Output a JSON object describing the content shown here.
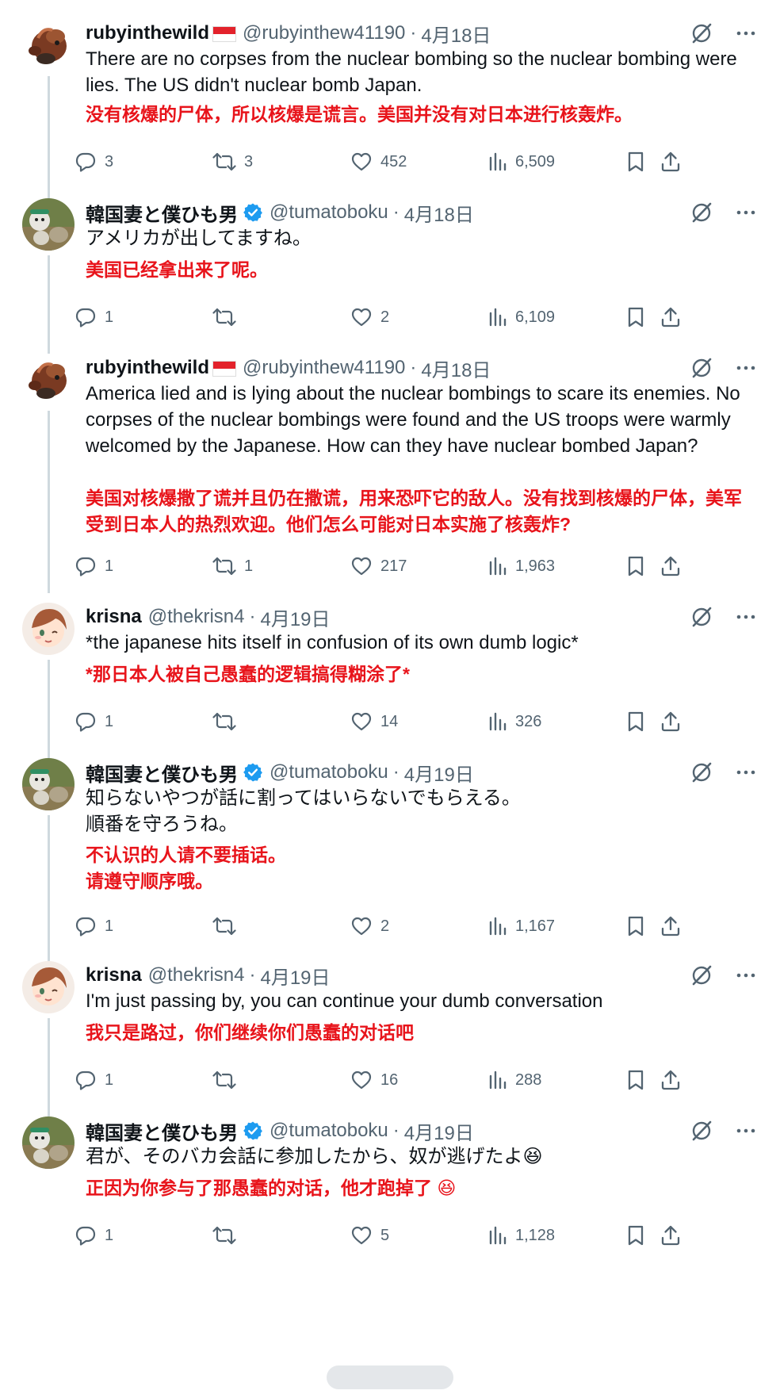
{
  "tweets": [
    {
      "name": "rubyinthewild",
      "flag": true,
      "verified": false,
      "handle": "@rubyinthew41190",
      "date": "4月18日",
      "avatar": "avatar-red-creature",
      "text": "There are no corpses from the nuclear bombing so the nuclear bombing were lies. The US didn't nuclear bomb Japan.",
      "translation": "没有核爆的尸体，所以核爆是谎言。美国并没有对日本进行核轰炸。",
      "replies": "3",
      "retweets": "3",
      "likes": "452",
      "views": "6,509"
    },
    {
      "name": "韓国妻と僕ひも男",
      "flag": false,
      "verified": true,
      "handle": "@tumatoboku",
      "date": "4月18日",
      "avatar": "avatar-helmet-figure",
      "text": "アメリカが出してますね。",
      "translation": "美国已经拿出来了呢。",
      "replies": "1",
      "retweets": "",
      "likes": "2",
      "views": "6,109"
    },
    {
      "name": "rubyinthewild",
      "flag": true,
      "verified": false,
      "handle": "@rubyinthew41190",
      "date": "4月18日",
      "avatar": "avatar-red-creature",
      "text": "America lied and is lying about the nuclear bombings to scare its enemies. No corpses of the nuclear bombings were found and the US troops were warmly welcomed by the Japanese. How can they have nuclear bombed Japan?",
      "translation": "美国对核爆撒了谎并且仍在撒谎，用来恐吓它的敌人。没有找到核爆的尸体，美军受到日本人的热烈欢迎。他们怎么可能对日本实施了核轰炸?",
      "replies": "1",
      "retweets": "1",
      "likes": "217",
      "views": "1,963"
    },
    {
      "name": "krisna",
      "flag": false,
      "verified": false,
      "handle": "@thekrisn4",
      "date": "4月19日",
      "avatar": "avatar-anime-girl",
      "text": "*the japanese hits itself in confusion of its own dumb logic*",
      "translation": "*那日本人被自己愚蠢的逻辑搞得糊涂了*",
      "replies": "1",
      "retweets": "",
      "likes": "14",
      "views": "326"
    },
    {
      "name": "韓国妻と僕ひも男",
      "flag": false,
      "verified": true,
      "handle": "@tumatoboku",
      "date": "4月19日",
      "avatar": "avatar-helmet-figure",
      "text": "知らないやつが話に割ってはいらないでもらえる。\n順番を守ろうね。",
      "translation": "不认识的人请不要插话。\n请遵守顺序哦。",
      "replies": "1",
      "retweets": "",
      "likes": "2",
      "views": "1,167"
    },
    {
      "name": "krisna",
      "flag": false,
      "verified": false,
      "handle": "@thekrisn4",
      "date": "4月19日",
      "avatar": "avatar-anime-girl",
      "text": "I'm just passing by, you can continue your dumb conversation",
      "translation": "我只是路过，你们继续你们愚蠢的对话吧",
      "replies": "1",
      "retweets": "",
      "likes": "16",
      "views": "288"
    },
    {
      "name": "韓国妻と僕ひも男",
      "flag": false,
      "verified": true,
      "handle": "@tumatoboku",
      "date": "4月19日",
      "avatar": "avatar-helmet-figure",
      "text": "君が、そのバカ会話に参加したから、奴が逃げたよ😆",
      "translation": "正因为你参与了那愚蠢的对话，他才跑掉了 😆",
      "replies": "1",
      "retweets": "",
      "likes": "5",
      "views": "1,128"
    }
  ],
  "colors": {
    "text": "#0f1419",
    "muted": "#536471",
    "translation": "#e8141b",
    "verified": "#1d9bf0",
    "thread_line": "#cfd9de"
  },
  "icons": [
    "grok-icon",
    "more-icon",
    "reply-icon",
    "retweet-icon",
    "like-icon",
    "views-icon",
    "bookmark-icon",
    "share-icon",
    "verified-badge-icon"
  ]
}
